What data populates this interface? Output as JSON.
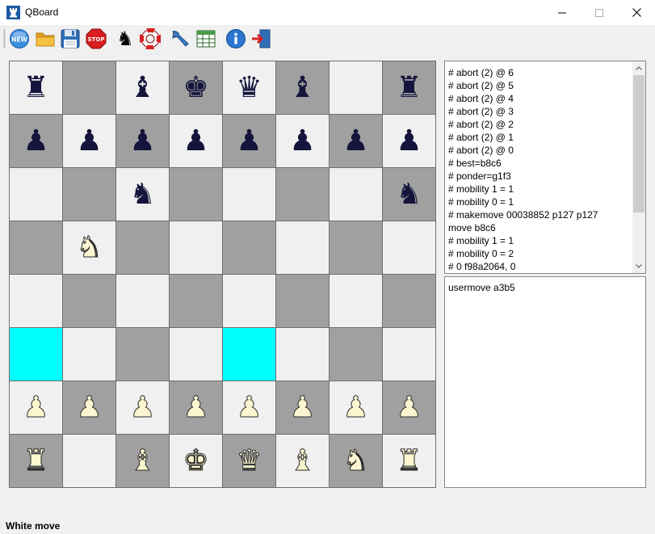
{
  "window": {
    "title": "QBoard",
    "app_icon": "rook-icon",
    "controls": [
      "minimize-icon",
      "maximize-icon",
      "close-icon"
    ]
  },
  "toolbar": {
    "buttons": [
      {
        "name": "new-game-button",
        "icon": "new-icon",
        "label": "NEW"
      },
      {
        "name": "open-button",
        "icon": "folder-icon"
      },
      {
        "name": "save-button",
        "icon": "floppy-disk-icon"
      },
      {
        "name": "stop-button",
        "icon": "stop-sign-icon",
        "label": "STOP"
      },
      {
        "name": "engine-button",
        "icon": "knight-icon"
      },
      {
        "name": "help-button",
        "icon": "lifebuoy-icon"
      },
      {
        "name": "settings-button",
        "icon": "wrench-icon"
      },
      {
        "name": "table-button",
        "icon": "table-icon"
      },
      {
        "name": "about-button",
        "icon": "info-icon"
      },
      {
        "name": "exit-button",
        "icon": "exit-door-icon"
      }
    ]
  },
  "board": {
    "colors": {
      "light": "#f0f0f0",
      "dark": "#a0a0a0",
      "highlight": "#00ffff",
      "black_piece": "#14143c",
      "white_piece": "#fbf6cf"
    },
    "ranks": [
      [
        "r",
        "",
        "b",
        "k",
        "q",
        "b",
        "",
        "r"
      ],
      [
        "p",
        "p",
        "p",
        "p",
        "p",
        "p",
        "p",
        "p"
      ],
      [
        "",
        "",
        "n",
        "",
        "",
        "",
        "",
        "n"
      ],
      [
        "",
        "N",
        "",
        "",
        "",
        "",
        "",
        ""
      ],
      [
        "",
        "",
        "",
        "",
        "",
        "",
        "",
        ""
      ],
      [
        "",
        "",
        "",
        "",
        "",
        "",
        "",
        ""
      ],
      [
        "P",
        "P",
        "P",
        "P",
        "P",
        "P",
        "P",
        "P"
      ],
      [
        "R",
        "",
        "B",
        "K",
        "Q",
        "B",
        "N",
        "R"
      ]
    ],
    "highlighted": [
      "a3",
      "e3"
    ]
  },
  "engine_log": {
    "lines": [
      "# abort (2) @ 6",
      "# abort (2) @ 5",
      "# abort (2) @ 4",
      "# abort (2) @ 3",
      "# abort (2) @ 2",
      "# abort (2) @ 1",
      "# abort (2) @ 0",
      "# best=b8c6",
      "# ponder=g1f3",
      "# mobility 1 = 1",
      "# mobility 0 = 1",
      "# makemove 00038852 p127 p127",
      "move b8c6",
      "# mobility 1 = 1",
      "# mobility 0 = 2",
      "# 0 f98a2064, 0"
    ]
  },
  "command_input": {
    "text": "usermove a3b5"
  },
  "status": {
    "text": "White move"
  }
}
